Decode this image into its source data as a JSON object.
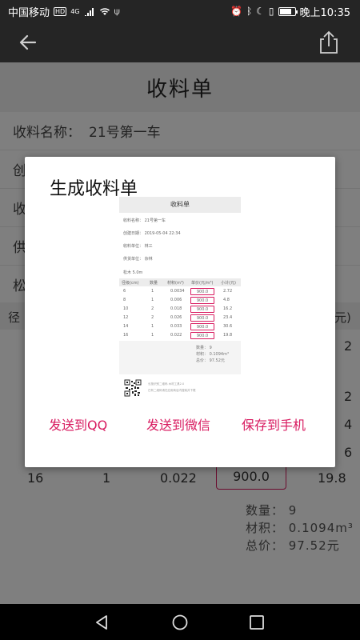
{
  "status_bar": {
    "carrier": "中国移动",
    "badge_hd": "HD",
    "network": "4G",
    "time": "晚上10:35",
    "icons": [
      "signal-icon",
      "wifi-icon",
      "usb-icon",
      "alarm-icon",
      "bluetooth-icon",
      "moon-icon",
      "vibrate-icon",
      "battery-icon"
    ],
    "battery_level": 0.8
  },
  "toolbar": {
    "back_icon": "arrow-back-icon",
    "share_icon": "share-icon"
  },
  "page": {
    "title": "收料单",
    "fields": [
      {
        "label": "收料名称：",
        "value": "21号第一车"
      },
      {
        "label": "创",
        "value": ""
      },
      {
        "label": "收",
        "value": ""
      },
      {
        "label": "供",
        "value": ""
      },
      {
        "label": "松",
        "value": ""
      }
    ],
    "table_header_left": "径",
    "table_header_right": "元)",
    "right_edge_values": [
      "2",
      "2",
      "4",
      "6"
    ],
    "last_row": {
      "diameter": "16",
      "qty": "1",
      "volume": "0.022",
      "price": "900.0",
      "subtotal": "19.8"
    },
    "summary": {
      "qty": "数量：  9",
      "volume": "材积：  0.1094m³",
      "total": "总价：  97.52元"
    }
  },
  "dialog": {
    "title": "生成收料单",
    "preview": {
      "title": "收料单",
      "name_line": "收料名称：  21号第一车",
      "date_line": "创建日期：  2019-05-04 22:34",
      "receiver_line": "收料单位：  林三",
      "supplier_line": "供货单位：  杂林",
      "length_line": "松木  5.0m",
      "headers": [
        "径级(cm)",
        "数量",
        "材积(m³)",
        "单价(元/m³)",
        "小计(元)"
      ],
      "rows": [
        [
          "6",
          "1",
          "0.0034",
          "900.0",
          "2.72"
        ],
        [
          "8",
          "1",
          "0.006",
          "900.0",
          "4.8"
        ],
        [
          "10",
          "2",
          "0.018",
          "900.0",
          "16.2"
        ],
        [
          "12",
          "2",
          "0.026",
          "900.0",
          "23.4"
        ],
        [
          "14",
          "1",
          "0.033",
          "900.0",
          "30.6"
        ],
        [
          "16",
          "1",
          "0.022",
          "900.0",
          "19.8"
        ]
      ],
      "sum_qty": "数量：  9",
      "sum_volume": "材积：  0.1094m³",
      "sum_total": "总价：  97.52元",
      "footer1": "长按识别二维码  木材工具2.0",
      "footer2": "已有二维码请在应用商店内搜索并下载"
    },
    "buttons": {
      "qq": "发送到QQ",
      "wechat": "发送到微信",
      "save": "保存到手机"
    }
  },
  "nav_bar": {
    "icons": [
      "nav-back-icon",
      "nav-home-icon",
      "nav-recents-icon"
    ]
  }
}
